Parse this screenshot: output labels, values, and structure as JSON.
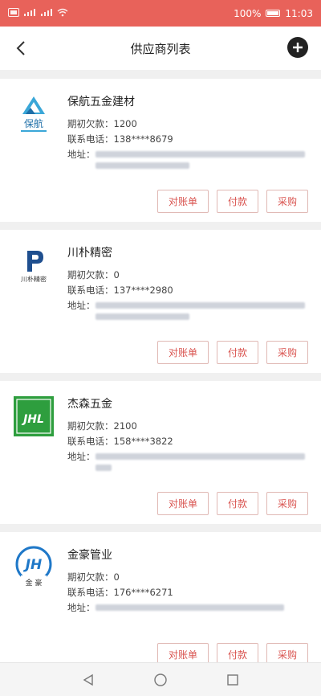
{
  "status_bar": {
    "left_icons": [
      "sim-icon",
      "signal-icon",
      "signal-icon",
      "wifi-icon"
    ],
    "battery": "100%",
    "time": "11:03"
  },
  "nav": {
    "title": "供应商列表"
  },
  "labels": {
    "opening_debt": "期初欠款：",
    "phone": "联系电话：",
    "address": "地址："
  },
  "suppliers": [
    {
      "name": "保航五金建材",
      "opening_debt": "1200",
      "phone": "138****8679",
      "logo_text": "保航",
      "logo_icon": "triangle-logo-icon",
      "actions": [
        "对账单",
        "付款",
        "采购"
      ]
    },
    {
      "name": "川朴精密",
      "opening_debt": "0",
      "phone": "137****2980",
      "logo_text": "川朴精密",
      "logo_icon": "letter-p-logo-icon",
      "actions": [
        "对账单",
        "付款",
        "采购"
      ]
    },
    {
      "name": "杰森五金",
      "opening_debt": "2100",
      "phone": "158****3822",
      "logo_text": "JHL",
      "logo_icon": "green-square-logo-icon",
      "actions": [
        "对账单",
        "付款",
        "采购"
      ]
    },
    {
      "name": "金豪管业",
      "opening_debt": "0",
      "phone": "176****6271",
      "logo_text": "JH",
      "logo_sub": "金 豪",
      "logo_icon": "circle-logo-icon",
      "actions": [
        "对账单",
        "付款",
        "采购"
      ]
    }
  ],
  "colors": {
    "status_bar": "#e8625a",
    "button_text": "#d9534f",
    "button_border": "#e0b8b4",
    "jhl_green": "#2e9e3e",
    "jh_blue": "#1f78c8",
    "baohang_blue": "#3aa7d8"
  }
}
